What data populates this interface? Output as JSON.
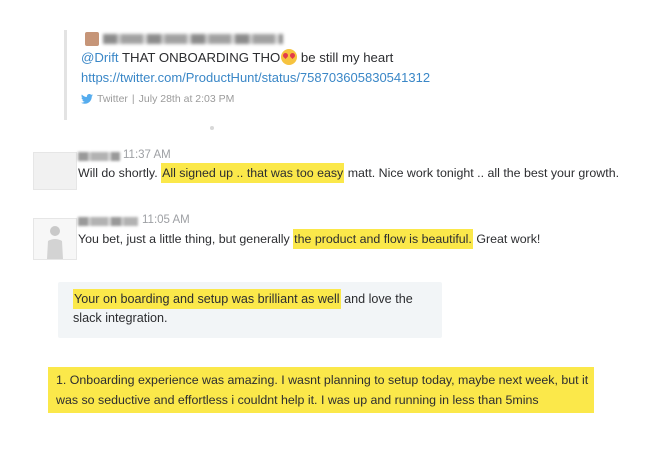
{
  "tweet": {
    "mention": "@Drift",
    "text_main": " THAT ONBOARDING THO",
    "text_tail": "  be still my heart",
    "link": "https://twitter.com/ProductHunt/status/758703605830541312",
    "source": "Twitter",
    "separator": "|",
    "timestamp": "July 28th at 2:03 PM"
  },
  "messages": [
    {
      "time": "11:37 AM",
      "text_before": "Will do shortly. ",
      "highlight": "All signed up .. that was too easy",
      "text_after": " matt. Nice work tonight .. all the best your growth."
    },
    {
      "time": "11:05 AM",
      "text_before": "You bet, just a little thing, but generally ",
      "highlight": "the product and flow is beautiful.",
      "text_after": " Great work!"
    }
  ],
  "quote": {
    "highlight": "Your on boarding and setup was brilliant as well",
    "text_after": " and love the slack integration."
  },
  "feedback": {
    "text": "1. Onboarding experience was amazing. I wasnt planning to setup today, maybe next week, but it was so seductive and effortless i couldnt help it. I was up and running in less than 5mins"
  },
  "colors": {
    "highlight": "#fbe84a",
    "link": "#3a87c7",
    "quote_bg": "#f2f5f7"
  },
  "icons": {
    "emoji": "heart-eyes-emoji",
    "twitter": "twitter-bird-icon"
  }
}
